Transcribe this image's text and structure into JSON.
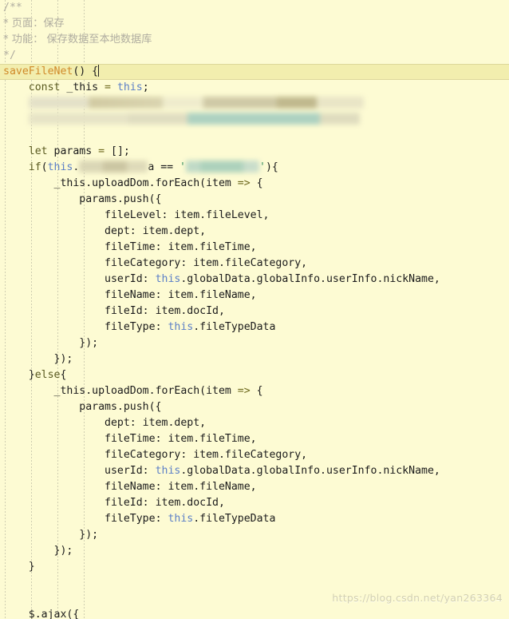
{
  "editor": {
    "language": "javascript",
    "theme_name": "light-yellow",
    "background_color": "#fdfbd3",
    "current_line_color": "#f2eeae",
    "watermark": "https://blog.csdn.net/yan263364",
    "cursor": {
      "line": 5,
      "column": 17
    }
  },
  "colors": {
    "comment": "#b0ada0",
    "keyword": "#5a5a20",
    "operator": "#6f6a1f",
    "this_keyword": "#5b7fc7",
    "function_name": "#d08a2a",
    "string": "#2e8b57",
    "plain_text": "#1b1b1b"
  },
  "code": {
    "comment_block": {
      "open": "/**",
      "line_page_marker": "*",
      "line_page": " 页面：保存",
      "line_func_marker": "*",
      "line_func": " 功能： 保存数据至本地数据库",
      "close": "*/"
    },
    "function_signature": {
      "name": "saveFileNet",
      "rest": "() {"
    },
    "lines": [
      {
        "indent": 4,
        "text": "const _this = this;",
        "tokens": [
          {
            "t": "kw",
            "v": "const"
          },
          {
            "t": "plain",
            "v": " _this "
          },
          {
            "t": "op",
            "v": "="
          },
          {
            "t": "plain",
            "v": " "
          },
          {
            "t": "this",
            "v": "this"
          },
          {
            "t": "plain",
            "v": ";"
          }
        ]
      },
      {
        "indent": 4,
        "redacted": true,
        "redaction_style": "blur-a"
      },
      {
        "indent": 4,
        "redacted": true,
        "redaction_style": "blur-b"
      },
      {
        "indent": 0,
        "blank": true
      },
      {
        "indent": 4,
        "tokens": [
          {
            "t": "kw",
            "v": "let"
          },
          {
            "t": "plain",
            "v": " params "
          },
          {
            "t": "op",
            "v": "="
          },
          {
            "t": "plain",
            "v": " [];"
          }
        ]
      },
      {
        "indent": 4,
        "redacted_partial": true,
        "tokens": [
          {
            "t": "kw",
            "v": "if"
          },
          {
            "t": "plain",
            "v": "("
          },
          {
            "t": "this",
            "v": "this"
          },
          {
            "t": "plain",
            "v": "."
          }
        ],
        "tail": "a == ",
        "string_blurred": true,
        "close": "){"
      },
      {
        "indent": 8,
        "tokens": [
          {
            "t": "plain",
            "v": "_this.uploadDom.forEach(item "
          },
          {
            "t": "op",
            "v": "=>"
          },
          {
            "t": "plain",
            "v": " {"
          }
        ]
      },
      {
        "indent": 12,
        "tokens": [
          {
            "t": "plain",
            "v": "params.push({"
          }
        ]
      },
      {
        "indent": 16,
        "tokens": [
          {
            "t": "plain",
            "v": "fileLevel: item.fileLevel,"
          }
        ]
      },
      {
        "indent": 16,
        "tokens": [
          {
            "t": "plain",
            "v": "dept: item.dept,"
          }
        ]
      },
      {
        "indent": 16,
        "tokens": [
          {
            "t": "plain",
            "v": "fileTime: item.fileTime,"
          }
        ]
      },
      {
        "indent": 16,
        "tokens": [
          {
            "t": "plain",
            "v": "fileCategory: item.fileCategory,"
          }
        ]
      },
      {
        "indent": 16,
        "tokens": [
          {
            "t": "plain",
            "v": "userId: "
          },
          {
            "t": "this",
            "v": "this"
          },
          {
            "t": "plain",
            "v": ".globalData.globalInfo.userInfo.nickName,"
          }
        ]
      },
      {
        "indent": 16,
        "tokens": [
          {
            "t": "plain",
            "v": "fileName: item.fileName,"
          }
        ]
      },
      {
        "indent": 16,
        "tokens": [
          {
            "t": "plain",
            "v": "fileId: item.docId,"
          }
        ]
      },
      {
        "indent": 16,
        "tokens": [
          {
            "t": "plain",
            "v": "fileType: "
          },
          {
            "t": "this",
            "v": "this"
          },
          {
            "t": "plain",
            "v": ".fileTypeData"
          }
        ]
      },
      {
        "indent": 12,
        "tokens": [
          {
            "t": "plain",
            "v": "});"
          }
        ]
      },
      {
        "indent": 8,
        "tokens": [
          {
            "t": "plain",
            "v": "});"
          }
        ]
      },
      {
        "indent": 4,
        "tokens": [
          {
            "t": "plain",
            "v": "}"
          },
          {
            "t": "kw",
            "v": "else"
          },
          {
            "t": "plain",
            "v": "{"
          }
        ]
      },
      {
        "indent": 8,
        "tokens": [
          {
            "t": "plain",
            "v": "_this.uploadDom.forEach(item "
          },
          {
            "t": "op",
            "v": "=>"
          },
          {
            "t": "plain",
            "v": " {"
          }
        ]
      },
      {
        "indent": 12,
        "tokens": [
          {
            "t": "plain",
            "v": "params.push({"
          }
        ]
      },
      {
        "indent": 16,
        "tokens": [
          {
            "t": "plain",
            "v": "dept: item.dept,"
          }
        ]
      },
      {
        "indent": 16,
        "tokens": [
          {
            "t": "plain",
            "v": "fileTime: item.fileTime,"
          }
        ]
      },
      {
        "indent": 16,
        "tokens": [
          {
            "t": "plain",
            "v": "fileCategory: item.fileCategory,"
          }
        ]
      },
      {
        "indent": 16,
        "tokens": [
          {
            "t": "plain",
            "v": "userId: "
          },
          {
            "t": "this",
            "v": "this"
          },
          {
            "t": "plain",
            "v": ".globalData.globalInfo.userInfo.nickName,"
          }
        ]
      },
      {
        "indent": 16,
        "tokens": [
          {
            "t": "plain",
            "v": "fileName: item.fileName,"
          }
        ]
      },
      {
        "indent": 16,
        "tokens": [
          {
            "t": "plain",
            "v": "fileId: item.docId,"
          }
        ]
      },
      {
        "indent": 16,
        "tokens": [
          {
            "t": "plain",
            "v": "fileType: "
          },
          {
            "t": "this",
            "v": "this"
          },
          {
            "t": "plain",
            "v": ".fileTypeData"
          }
        ]
      },
      {
        "indent": 12,
        "tokens": [
          {
            "t": "plain",
            "v": "});"
          }
        ]
      },
      {
        "indent": 8,
        "tokens": [
          {
            "t": "plain",
            "v": "});"
          }
        ]
      },
      {
        "indent": 4,
        "tokens": [
          {
            "t": "plain",
            "v": "}"
          }
        ]
      },
      {
        "indent": 0,
        "blank": true
      },
      {
        "indent": 0,
        "blank": true
      },
      {
        "indent": 4,
        "tokens": [
          {
            "t": "plain",
            "v": "$.ajax({"
          }
        ]
      }
    ]
  }
}
